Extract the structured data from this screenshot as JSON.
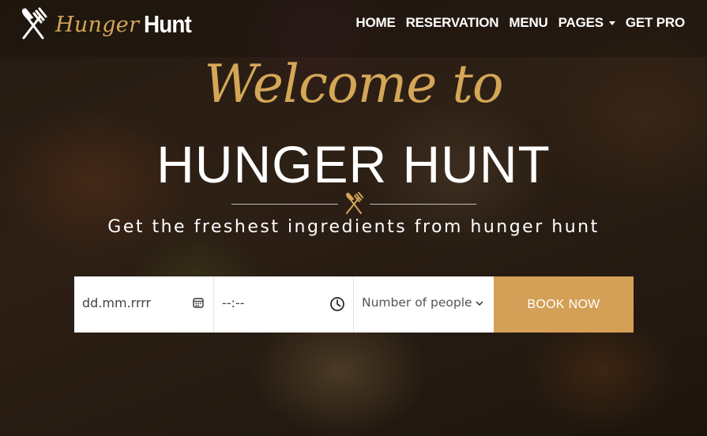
{
  "brand": {
    "script": "Hunger",
    "bold": "Hunt",
    "logo_icon": "fork-knife-icon",
    "accent": "#d4a657"
  },
  "nav": {
    "items": [
      {
        "label": "HOME"
      },
      {
        "label": "RESERVATION"
      },
      {
        "label": "MENU"
      },
      {
        "label": "PAGES",
        "has_dropdown": true
      },
      {
        "label": "GET PRO"
      }
    ]
  },
  "hero": {
    "welcome": "Welcome to",
    "title": "HUNGER HUNT",
    "divider_icon": "fork-knife-icon",
    "subtitle": "Get the freshest ingredients from hunger hunt"
  },
  "booking": {
    "date_value": "dd.mm.rrrr",
    "time_value": "--:--",
    "people_value": "Number of people",
    "button_label": "BOOK NOW",
    "button_color": "#d4a057"
  }
}
